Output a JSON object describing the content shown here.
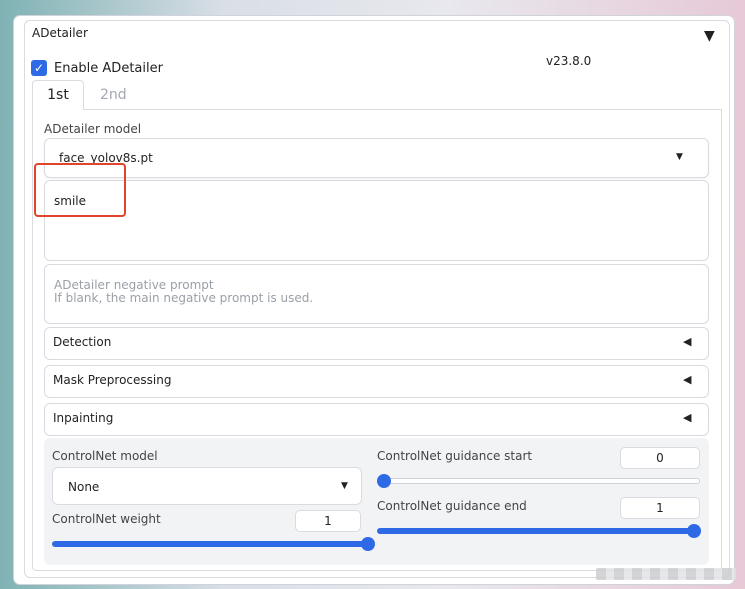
{
  "panel": {
    "title": "ADetailer",
    "collapse_icon": "triangle-down-icon",
    "enable_label": "Enable ADetailer",
    "enabled": true,
    "version": "v23.8.0"
  },
  "tabs": [
    {
      "label": "1st",
      "active": true
    },
    {
      "label": "2nd",
      "active": false
    }
  ],
  "model": {
    "label": "ADetailer model",
    "value": "face_yolov8s.pt"
  },
  "prompt": {
    "value": "smile"
  },
  "negative_prompt": {
    "placeholder_line1": "ADetailer negative prompt",
    "placeholder_line2": "If blank, the main negative prompt is used."
  },
  "accordions": [
    {
      "label": "Detection"
    },
    {
      "label": "Mask Preprocessing"
    },
    {
      "label": "Inpainting"
    }
  ],
  "controlnet": {
    "model_label": "ControlNet model",
    "model_value": "None",
    "weight_label": "ControlNet weight",
    "weight_value": "1",
    "guidance_start_label": "ControlNet guidance start",
    "guidance_start_value": "0",
    "guidance_end_label": "ControlNet guidance end",
    "guidance_end_value": "1"
  },
  "colors": {
    "accent": "#2e6ae6",
    "highlight": "#e0452b"
  }
}
